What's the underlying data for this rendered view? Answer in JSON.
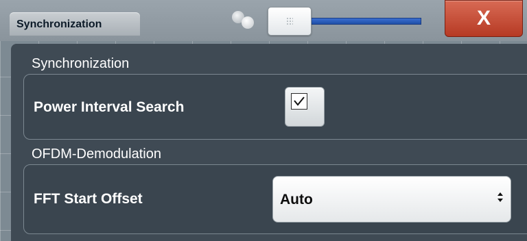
{
  "window": {
    "title": "Synchronization",
    "close_label": "X"
  },
  "synchronization": {
    "section_title": "Synchronization",
    "power_interval_search_label": "Power Interval Search",
    "power_interval_search_checked": true
  },
  "ofdm": {
    "section_title": "OFDM-Demodulation",
    "fft_start_offset_label": "FFT Start Offset",
    "fft_start_offset_value": "Auto"
  },
  "colors": {
    "dialog_background": "#3f4a54",
    "close_button": "#b63a24",
    "slider_track": "#3a6ed0"
  },
  "icons": {
    "close": "close-icon",
    "checkmark": "checkmark-icon",
    "dropdown_arrows": "up-down-arrows-icon"
  }
}
